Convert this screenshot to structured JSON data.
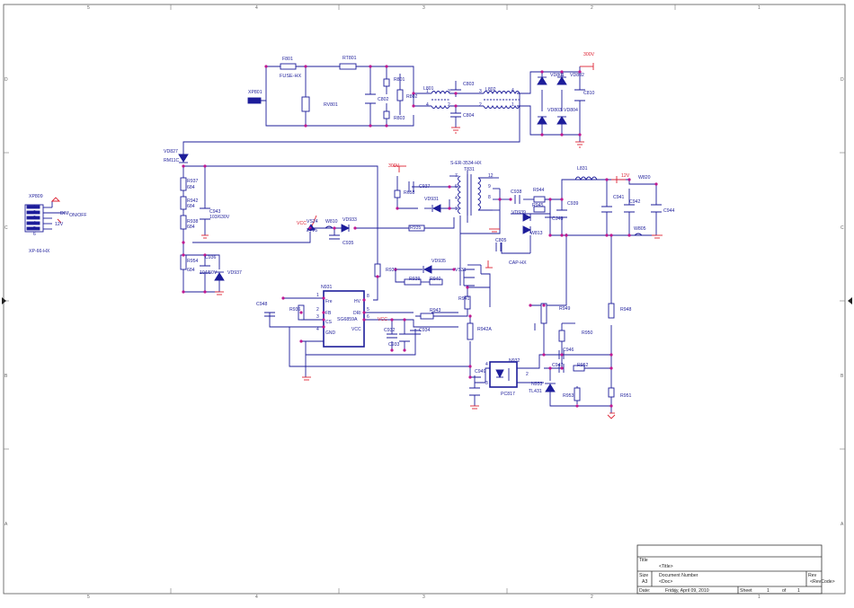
{
  "border": {
    "cols_top": [
      "5",
      "4",
      "3",
      "2",
      "1"
    ],
    "cols_bottom": [
      "5",
      "4",
      "3",
      "2",
      "1"
    ],
    "rows": [
      "D",
      "C",
      "B",
      "A"
    ]
  },
  "labels": {
    "v300_top": "300V",
    "v300_mid": "300V",
    "v12": "12V",
    "vcc_a": "VCC",
    "vcc_b": "VCC",
    "xp801": "XP801",
    "f801": "F801",
    "fuse": "FUSE-HX",
    "rt801": "RT801",
    "rv801": "RV801",
    "r801": "R801",
    "r802": "R802",
    "r803": "R803",
    "c802": "C802",
    "l801": "L801",
    "c803": "C803",
    "c804": "C804",
    "l802": "L802",
    "vd801": "VD801",
    "vd802": "VD802",
    "vd803": "VD803",
    "vd804": "VD804",
    "c810": "C810",
    "vd827": "VD827",
    "rm11c": "RM11C",
    "r937": "R937",
    "r942": "R942",
    "r938": "R938",
    "v684a": "684",
    "v684b": "684",
    "v684c": "684",
    "v684d": "684",
    "c943": "C943",
    "c943v": "103/630V",
    "r954": "R954",
    "c936": "C936",
    "c936v": "104/50V",
    "vd937": "VD937",
    "xp809": "XP809",
    "xp809_type": "XP-66-HX",
    "dim": "DIM",
    "onoff": "ON/OFF",
    "v12b": "12V",
    "vs24": "VS24",
    "vs24v": "24V5",
    "w810": "W810",
    "vd933": "VD933",
    "c935": "C935",
    "r935": "R935",
    "c937": "C937",
    "r658": "R658",
    "vd931": "VD931",
    "t831_part": "S-ER-3534-HX",
    "t831": "T831",
    "c938": "C938",
    "r944": "R944",
    "r945": "R945",
    "vd939": "VD939",
    "w813": "W813",
    "c940": "C940",
    "c939": "C939",
    "c805": "C805",
    "cap_hx": "CAP-HX",
    "l831": "L831",
    "w820": "W820",
    "c941": "C941",
    "c942": "C942",
    "c944": "C944",
    "w805": "W805",
    "r931": "R931",
    "vd935": "VD935",
    "vs31": "VS31",
    "r939": "R939",
    "r940": "R940",
    "r941": "R941",
    "n931": "N931",
    "ic_part": "SG6859A",
    "pin_fb": "FB",
    "pin_cs": "CS",
    "pin_gnd": "GND",
    "pin_hv": "HV",
    "pin_drv": "DRI",
    "pin_vcc": "VCC",
    "pin_frq": "Fre",
    "c948": "C948",
    "r936": "R936",
    "c932": "C932",
    "c934": "C934",
    "c933": "C933",
    "r943": "R943",
    "r942a": "R942A",
    "n932": "N932",
    "pc817": "PC817",
    "c949": "C949",
    "r949": "R949",
    "r950": "R950",
    "c946": "C946",
    "c947": "C947",
    "r952": "R952",
    "n933": "N933",
    "tl431": "TL431",
    "r953": "R953",
    "r948": "R948",
    "r951": "R951"
  },
  "titleblock": {
    "title_label": "Title",
    "title_value": "<Title>",
    "size_label": "Size",
    "size_value": "A3",
    "docnum_label": "Document Number",
    "docnum_value": "<Doc>",
    "rev_label": "Rev",
    "rev_value": "<RevCode>",
    "date_label": "Date:",
    "date_value": "Friday, April 09, 2010",
    "sheet_label": "Sheet",
    "sheet_value": "1",
    "of_label": "of",
    "of_value": "1"
  }
}
